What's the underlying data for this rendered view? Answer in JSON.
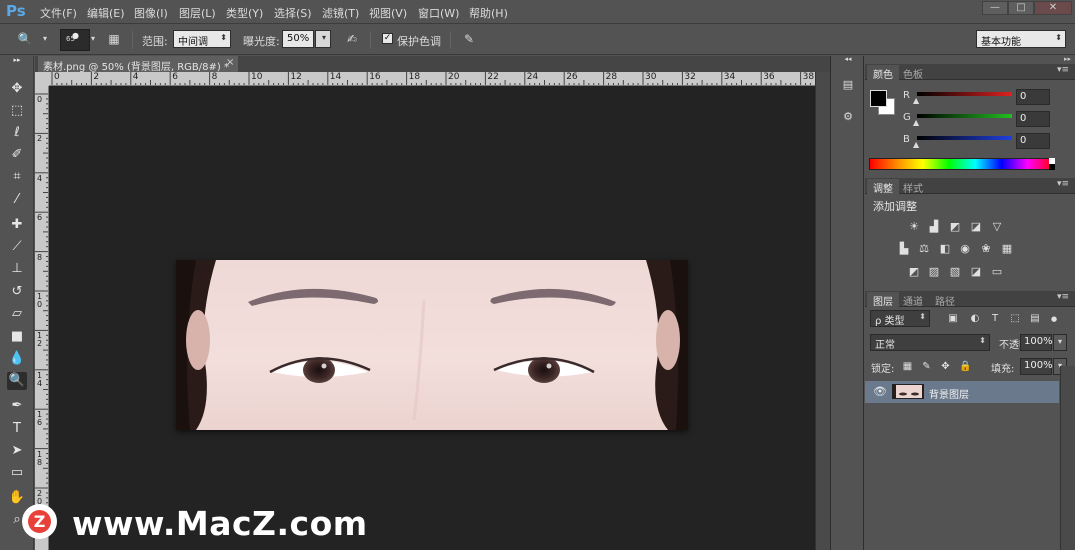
{
  "app": {
    "logo": "Ps"
  },
  "menu": {
    "items": [
      "文件(F)",
      "编辑(E)",
      "图像(I)",
      "图层(L)",
      "类型(Y)",
      "选择(S)",
      "滤镜(T)",
      "视图(V)",
      "窗口(W)",
      "帮助(H)"
    ]
  },
  "window_controls": {
    "minimize": "—",
    "restore": "□",
    "close": "✕"
  },
  "options": {
    "brush_size": "65",
    "range_label": "范围:",
    "range_value": "中间调",
    "exposure_label": "曝光度:",
    "exposure_value": "50%",
    "protect_tones_label": "保护色调",
    "protect_tones_checked": "✓",
    "workspace": "基本功能"
  },
  "document": {
    "tab_title": "素材.png @ 50% (背景图层, RGB/8#) *",
    "close": "×"
  },
  "ruler": {
    "h_labels": [
      "0",
      "2",
      "4",
      "6",
      "8",
      "10",
      "12",
      "14",
      "16",
      "18",
      "20",
      "22",
      "24",
      "26",
      "28",
      "30",
      "32",
      "34",
      "36",
      "38"
    ],
    "v_labels": [
      "0",
      "2",
      "4",
      "6",
      "8",
      "10",
      "12",
      "14",
      "16",
      "18",
      "20"
    ]
  },
  "color_panel": {
    "tabs": [
      "颜色",
      "色板"
    ],
    "channels": [
      {
        "label": "R",
        "value": "0",
        "color": "#e02020"
      },
      {
        "label": "G",
        "value": "0",
        "color": "#20c020"
      },
      {
        "label": "B",
        "value": "0",
        "color": "#2040e0"
      }
    ]
  },
  "adjustments_panel": {
    "tabs": [
      "调整",
      "样式"
    ],
    "title": "添加调整"
  },
  "layers_panel": {
    "tabs": [
      "图层",
      "通道",
      "路径"
    ],
    "filter": "ρ 类型",
    "blend_mode": "正常",
    "opacity_label": "不透明度:",
    "opacity_value": "100%",
    "lock_label": "锁定:",
    "fill_label": "填充:",
    "fill_value": "100%",
    "layers": [
      {
        "name": "背景图层"
      }
    ]
  },
  "watermark": {
    "badge": "Z",
    "text": "www.MacZ.com"
  }
}
